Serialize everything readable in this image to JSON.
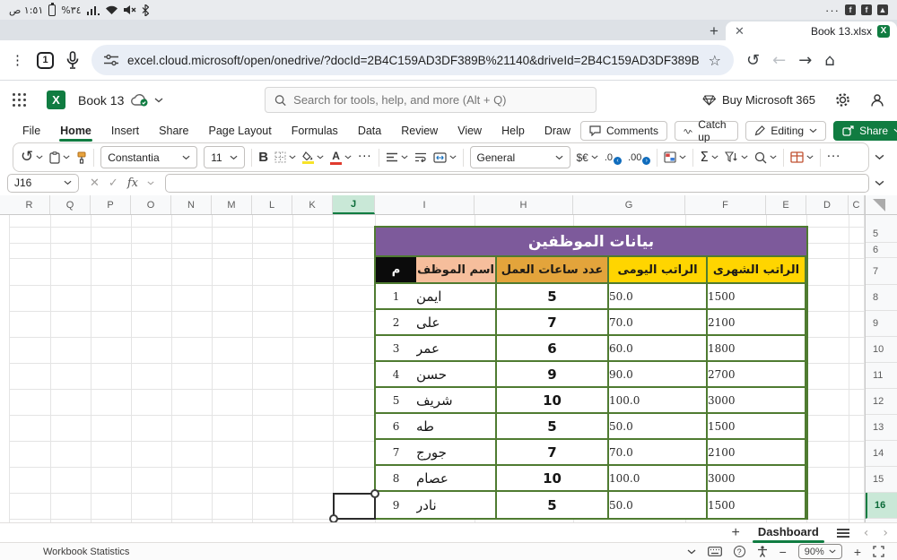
{
  "colors": {
    "excel_green": "#107C41",
    "table_border_green": "#4F7B31",
    "title_purple": "#7D5A9B",
    "header_yellow": "#FFD500",
    "header_orange": "#E3A43B",
    "header_peach": "#F6BE9C",
    "header_black": "#0B0B0B",
    "selected_header_bg": "#C9E8D7"
  },
  "system_bar": {
    "time": "١:٥١ ص",
    "battery": "٣٤%"
  },
  "browser": {
    "tab_title": "Book 13.xlsx",
    "tab_count": "1",
    "url": "excel.cloud.microsoft/open/onedrive/?docId=2B4C159AD3DF389B%21140&driveId=2B4C159AD3DF389B"
  },
  "app_bar": {
    "workbook_name": "Book 13",
    "search_placeholder": "Search for tools, help, and more (Alt + Q)",
    "buy_label": "Buy Microsoft 365"
  },
  "ribbon": {
    "tabs": [
      "File",
      "Home",
      "Insert",
      "Share",
      "Page Layout",
      "Formulas",
      "Data",
      "Review",
      "View",
      "Help",
      "Draw"
    ],
    "active_tab": "Home",
    "comments_label": "Comments",
    "catch_up_label": "Catch up",
    "editing_label": "Editing",
    "share_label": "Share"
  },
  "toolbar": {
    "font_name": "Constantia",
    "font_size": "11",
    "bold_label": "B",
    "number_format": "General",
    "currency_label": "$€",
    "decrease_decimal": ".0",
    "increase_decimal": ".00",
    "sum_label": "Σ"
  },
  "formula_bar": {
    "name_box": "J16",
    "formula": "",
    "fx_label": "fx"
  },
  "grid": {
    "columns": [
      "R",
      "Q",
      "P",
      "O",
      "N",
      "M",
      "L",
      "K",
      "J",
      "I",
      "H",
      "G",
      "F",
      "E",
      "D",
      "C"
    ],
    "selected_column": "J",
    "row_numbers": [
      "5",
      "6",
      "7",
      "8",
      "9",
      "10",
      "11",
      "12",
      "13",
      "14",
      "15",
      "16"
    ],
    "selected_row": "16",
    "active_cell": "J16"
  },
  "table": {
    "title": "بيانات الموظفين",
    "headers": {
      "monthly": "الراتب الشهرى",
      "daily": "الراتب اليومى",
      "hours": "عدد ساعات العمل",
      "name": "اسم الموظف",
      "num": "م"
    },
    "rows": [
      {
        "num": "1",
        "name": "ايمن",
        "hours": "5",
        "daily": "50.0",
        "monthly": "1500"
      },
      {
        "num": "2",
        "name": "على",
        "hours": "7",
        "daily": "70.0",
        "monthly": "2100"
      },
      {
        "num": "3",
        "name": "عمر",
        "hours": "6",
        "daily": "60.0",
        "monthly": "1800"
      },
      {
        "num": "4",
        "name": "حسن",
        "hours": "9",
        "daily": "90.0",
        "monthly": "2700"
      },
      {
        "num": "5",
        "name": "شريف",
        "hours": "10",
        "daily": "100.0",
        "monthly": "3000"
      },
      {
        "num": "6",
        "name": "طه",
        "hours": "5",
        "daily": "50.0",
        "monthly": "1500"
      },
      {
        "num": "7",
        "name": "جورج",
        "hours": "7",
        "daily": "70.0",
        "monthly": "2100"
      },
      {
        "num": "8",
        "name": "عصام",
        "hours": "10",
        "daily": "100.0",
        "monthly": "3000"
      },
      {
        "num": "9",
        "name": "نادر",
        "hours": "5",
        "daily": "50.0",
        "monthly": "1500"
      }
    ]
  },
  "sheet_bar": {
    "active_sheet": "Dashboard"
  },
  "status_bar": {
    "left_label": "Workbook Statistics",
    "zoom_level": "90%"
  }
}
